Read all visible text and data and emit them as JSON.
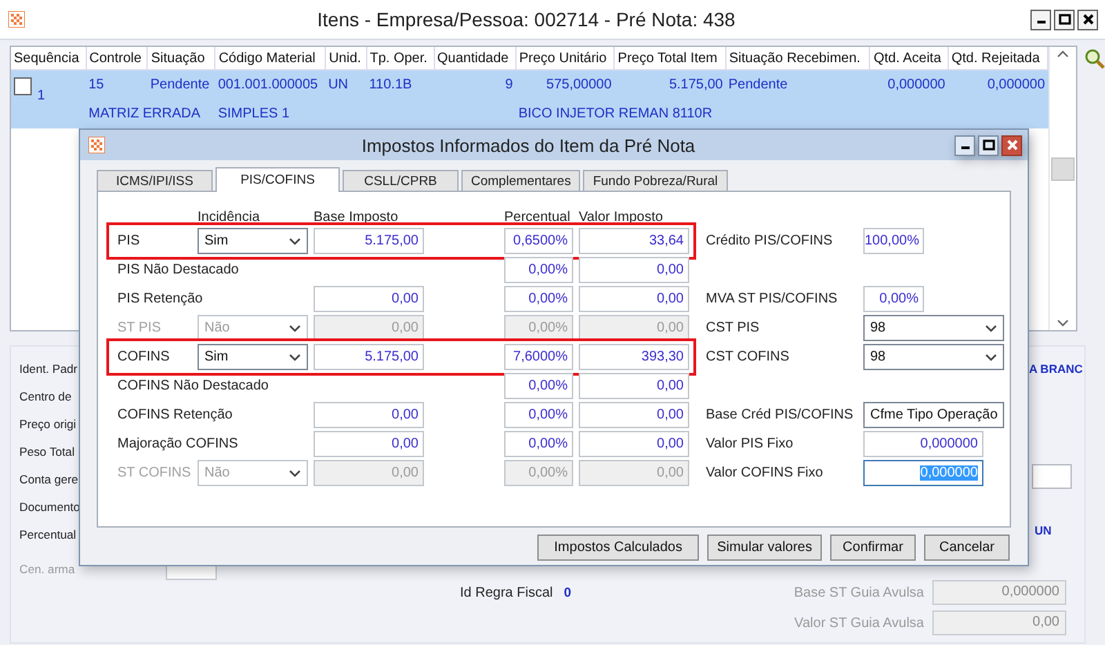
{
  "window": {
    "title": "Itens - Empresa/Pessoa: 002714 - Pré Nota: 438"
  },
  "items_table": {
    "columns": [
      "Sequência",
      "Controle",
      "Situação",
      "Código Material",
      "Unid.",
      "Tp. Oper.",
      "Quantidade",
      "Preço Unitário",
      "Preço Total Item",
      "Situação Recebimen.",
      "Qtd. Aceita",
      "Qtd. Rejeitada"
    ],
    "rows": [
      {
        "selected": true,
        "checked": false,
        "cells": [
          "1",
          "15",
          "Pendente",
          "001.001.000005",
          "UN",
          "110.1B",
          "9",
          "575,00000",
          "5.175,00",
          "Pendente",
          "0,000000",
          "0,000000"
        ],
        "detail": {
          "controle": "MATRIZ ERRADA",
          "codigo": "SIMPLES 1",
          "descricao": "BICO INJETOR REMAN 8110R"
        }
      }
    ]
  },
  "form": {
    "left_labels": [
      "Ident. Padr",
      "Centro de",
      "Preço origi",
      "Peso Total",
      "Conta gere",
      "Documento",
      "Percentual"
    ],
    "storage_label": "Cen. arma",
    "side_values": [
      "A BRANC",
      "UN"
    ],
    "fiscal_rule": {
      "label": "Id Regra Fiscal",
      "value": "0"
    },
    "guia_fields": [
      {
        "label": "Base ST Guia Avulsa",
        "value": "0,000000",
        "disabled": true
      },
      {
        "label": "Valor ST Guia Avulsa",
        "value": "0,00",
        "disabled": true
      }
    ]
  },
  "dialog": {
    "title": "Impostos Informados do Item da Pré Nota",
    "tabs": [
      {
        "label": "ICMS/IPI/ISS",
        "selected": false
      },
      {
        "label": "PIS/COFINS",
        "selected": true
      },
      {
        "label": "CSLL/CPRB",
        "selected": false
      },
      {
        "label": "Complementares",
        "selected": false
      },
      {
        "label": "Fundo Pobreza/Rural",
        "selected": false
      }
    ],
    "headers": {
      "incidence": "Incidência",
      "base": "Base Imposto",
      "percent": "Percentual",
      "value": "Valor Imposto"
    },
    "rows": [
      {
        "label": "PIS",
        "disabled": false,
        "highlighted": true,
        "incidence": "Sim",
        "base": "5.175,00",
        "percent": "0,6500%",
        "value": "33,64",
        "side": {
          "label": "Crédito PIS/COFINS",
          "kind": "short",
          "value": "100,00%",
          "focused": false
        }
      },
      {
        "label": "PIS Não Destacado",
        "disabled": false,
        "highlighted": false,
        "percent": "0,00%",
        "value": "0,00"
      },
      {
        "label": "PIS Retenção",
        "disabled": false,
        "highlighted": false,
        "base": "0,00",
        "percent": "0,00%",
        "value": "0,00",
        "side": {
          "label": "MVA ST PIS/COFINS",
          "kind": "short",
          "value": "0,00%",
          "focused": false
        }
      },
      {
        "label": "ST PIS",
        "disabled": true,
        "highlighted": false,
        "incidence": "Não",
        "base": "0,00",
        "percent": "0,00%",
        "value": "0,00",
        "side": {
          "label": "CST PIS",
          "kind": "select",
          "value": "98",
          "focused": false
        }
      },
      {
        "label": "COFINS",
        "disabled": false,
        "highlighted": true,
        "incidence": "Sim",
        "base": "5.175,00",
        "percent": "7,6000%",
        "value": "393,30",
        "side": {
          "label": "CST COFINS",
          "kind": "select",
          "value": "98",
          "focused": false
        }
      },
      {
        "label": "COFINS Não Destacado",
        "disabled": false,
        "highlighted": false,
        "percent": "0,00%",
        "value": "0,00"
      },
      {
        "label": "COFINS Retenção",
        "disabled": false,
        "highlighted": false,
        "base": "0,00",
        "percent": "0,00%",
        "value": "0,00",
        "side": {
          "label": "Base Créd PIS/COFINS",
          "kind": "select",
          "value": "Cfme Tipo Operação",
          "focused": false
        }
      },
      {
        "label": "Majoração COFINS",
        "disabled": false,
        "highlighted": false,
        "base": "0,00",
        "percent": "0,00%",
        "value": "0,00",
        "side": {
          "label": "Valor PIS Fixo",
          "kind": "field",
          "value": "0,000000",
          "focused": false
        }
      },
      {
        "label": "ST COFINS",
        "disabled": true,
        "highlighted": false,
        "incidence": "Não",
        "base": "0,00",
        "percent": "0,00%",
        "value": "0,00",
        "side": {
          "label": "Valor COFINS Fixo",
          "kind": "field",
          "value": "0,000000",
          "focused": true
        }
      }
    ],
    "buttons": [
      "Impostos Calculados",
      "Simular valores",
      "Confirmar",
      "Cancelar"
    ]
  }
}
